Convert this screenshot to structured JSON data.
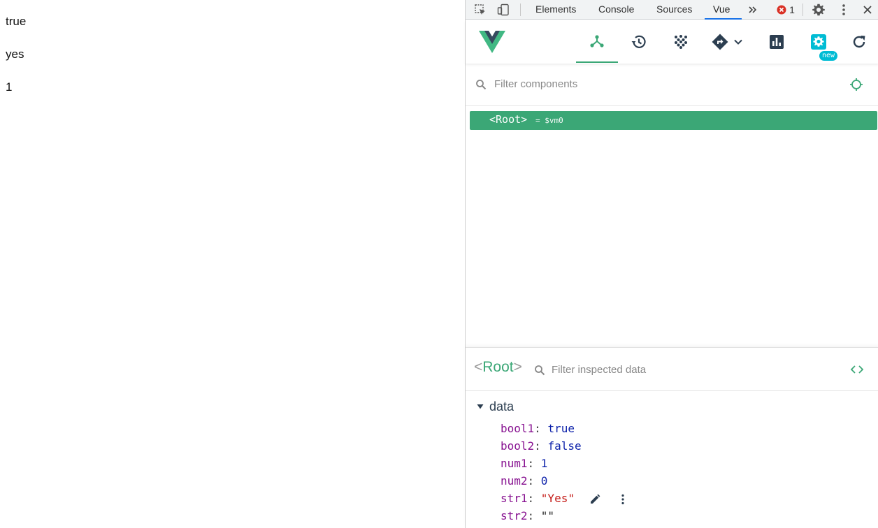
{
  "page": {
    "lines": [
      "true",
      "yes",
      "1"
    ]
  },
  "devtools": {
    "tabs": [
      "Elements",
      "Console",
      "Sources",
      "Vue"
    ],
    "active_tab": "Vue",
    "error_count": "1"
  },
  "vue": {
    "new_badge": "new",
    "filter_placeholder": "Filter components",
    "root_tag": "<Root>",
    "root_vm": "= $vm0",
    "inspector": {
      "title": "Root",
      "filter_placeholder": "Filter inspected data",
      "section": "data",
      "props": [
        {
          "key": "bool1",
          "value": "true"
        },
        {
          "key": "bool2",
          "value": "false"
        },
        {
          "key": "num1",
          "value": "1"
        },
        {
          "key": "num2",
          "value": "0"
        },
        {
          "key": "str1",
          "value": "\"Yes\""
        },
        {
          "key": "str2",
          "value": "\"\""
        }
      ]
    }
  },
  "colors": {
    "vue_green": "#3ba776",
    "accent_blue": "#1a73e8",
    "badge_cyan": "#00bcd4",
    "error_red": "#d93025"
  }
}
